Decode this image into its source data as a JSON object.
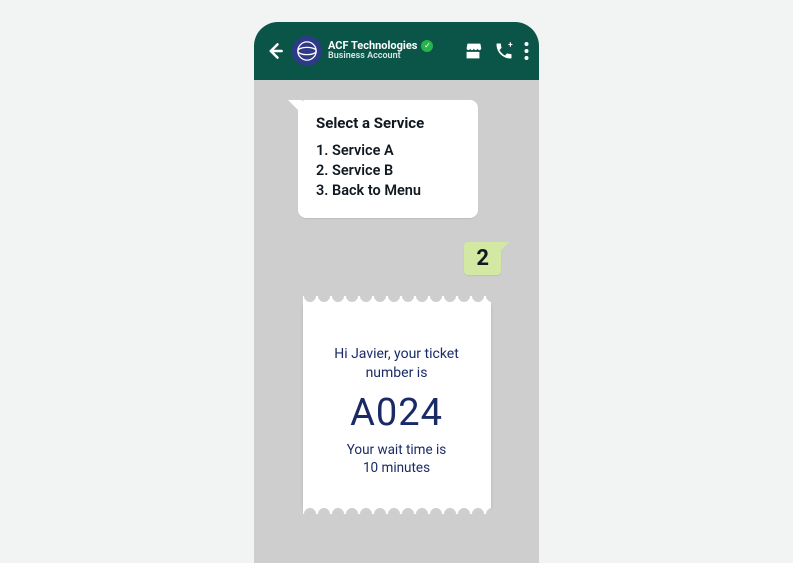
{
  "header": {
    "title": "ACF Technologies",
    "subtitle": "Business Account"
  },
  "service_menu": {
    "heading": "Select a Service",
    "options": [
      "1.  Service A",
      "2. Service B",
      "3. Back to Menu"
    ]
  },
  "user_reply": "2",
  "ticket": {
    "greeting": "Hi Javier, your ticket number is",
    "number": "A024",
    "wait_line1": "Your wait time is",
    "wait_line2": "10 minutes"
  }
}
